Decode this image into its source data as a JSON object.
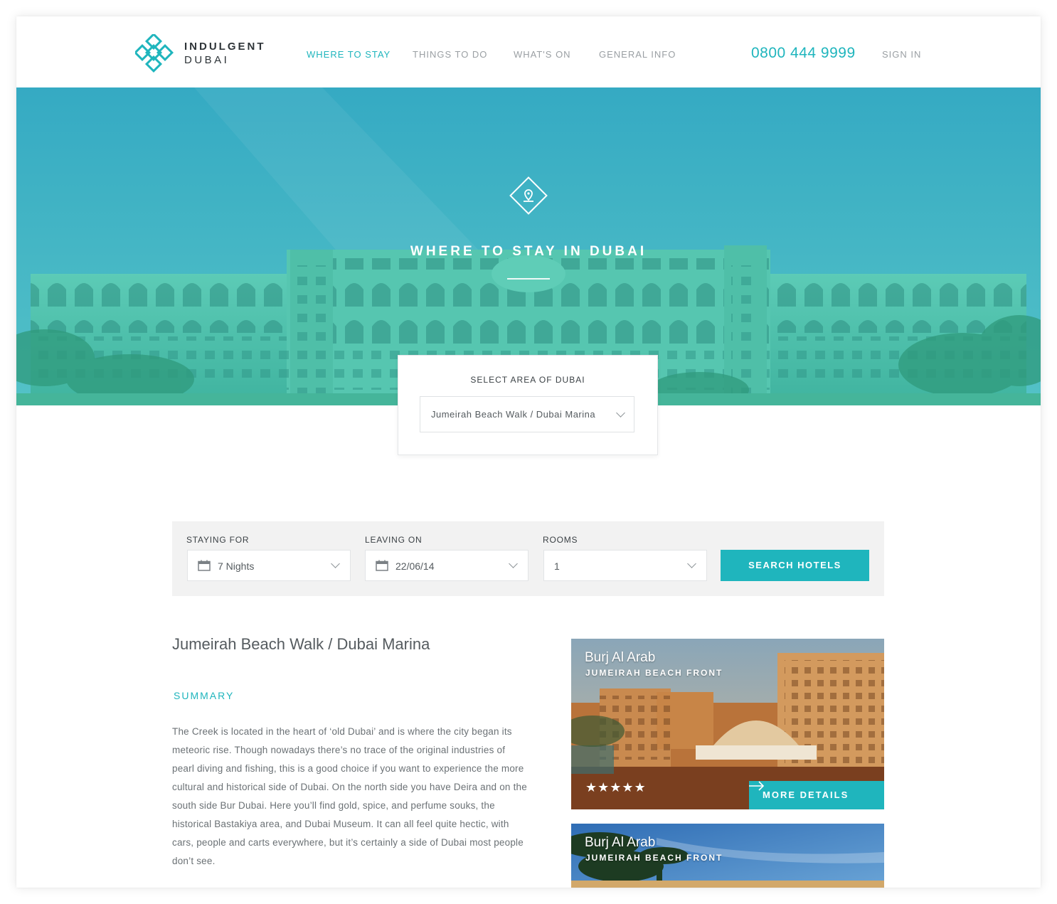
{
  "brand": {
    "line1": "INDULGENT",
    "line2": "DUBAI"
  },
  "nav": {
    "items": [
      "WHERE TO STAY",
      "THINGS TO DO",
      "WHAT'S ON",
      "GENERAL INFO"
    ],
    "active": "WHERE TO STAY"
  },
  "header": {
    "phone": "0800 444 9999",
    "signin": "SIGN IN"
  },
  "hero": {
    "icon": "location-pin-icon",
    "title": "WHERE TO STAY IN DUBAI"
  },
  "area_selector": {
    "label": "SELECT AREA OF DUBAI",
    "selected": "Jumeirah Beach Walk / Dubai Marina"
  },
  "search": {
    "staying_for": {
      "label": "STAYING FOR",
      "value": "7 Nights"
    },
    "leaving_on": {
      "label": "LEAVING ON",
      "value": "22/06/14"
    },
    "rooms": {
      "label": "ROOMS",
      "value": "1"
    },
    "button": "SEARCH HOTELS"
  },
  "content": {
    "heading": "Jumeirah Beach Walk / Dubai Marina",
    "summary_label": "SUMMARY",
    "summary_text": "The Creek is located in the heart of ‘old Dubai’ and is where the city began its meteoric rise. Though nowadays there’s no trace of the original industries of pearl diving and fishing, this is a good choice if you want to experience the more cultural and historical side of Dubai. On the north side you have Deira and on the south side Bur Dubai. Here you’ll find gold, spice, and perfume souks, the historical Bastakiya area, and Dubai Museum. It can all feel quite hectic, with cars, people and carts everywhere, but it’s certainly a side of Dubai most people don’t see."
  },
  "hotels": [
    {
      "name": "Burj Al Arab",
      "area": "JUMEIRAH BEACH FRONT",
      "rating": 5,
      "stars": "★★★★★",
      "button": "MORE DETAILS"
    },
    {
      "name": "Burj Al Arab",
      "area": "JUMEIRAH BEACH FRONT"
    }
  ],
  "colors": {
    "accent": "#1fb5bd",
    "hero_tint": "#35b7c4",
    "text": "#555b5f"
  }
}
